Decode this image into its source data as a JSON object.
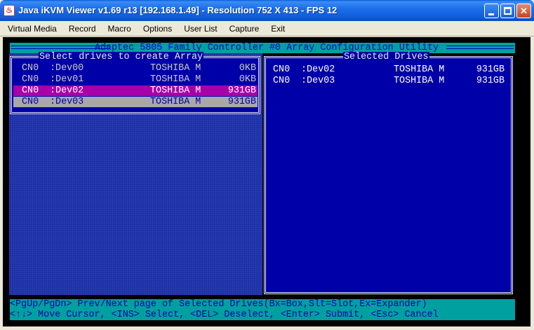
{
  "window": {
    "title": "Java iKVM Viewer v1.69 r13 [192.168.1.49]  - Resolution 752 X 413 - FPS 12",
    "app_icon": "java-cup-icon"
  },
  "menu": [
    "Virtual Media",
    "Record",
    "Macro",
    "Options",
    "User List",
    "Capture",
    "Exit"
  ],
  "console": {
    "header": " Adaptec 5805 Family Controller #0 Array Configuration Utility ",
    "left_title": "Select drives to create Array",
    "right_title": "Selected Drives",
    "drives": [
      {
        "channel": "CN0",
        "device": ":Dev00",
        "vendor": "TOSHIBA M",
        "size": "0KB",
        "state": "normal"
      },
      {
        "channel": "CN0",
        "device": ":Dev01",
        "vendor": "TOSHIBA M",
        "size": "0KB",
        "state": "normal"
      },
      {
        "channel": "CN0",
        "device": ":Dev02",
        "vendor": "TOSHIBA M",
        "size": "931GB",
        "state": "selected"
      },
      {
        "channel": "CN0",
        "device": ":Dev03",
        "vendor": "TOSHIBA M",
        "size": "931GB",
        "state": "cursor"
      }
    ],
    "selected": [
      {
        "channel": "CN0",
        "device": ":Dev02",
        "vendor": "TOSHIBA M",
        "size": "931GB"
      },
      {
        "channel": "CN0",
        "device": ":Dev03",
        "vendor": "TOSHIBA M",
        "size": "931GB"
      }
    ],
    "footer": [
      "<PgUp/PgDn> Prev/Next page of Selected Drives(Bx=Box,Slt=Slot,Ex=Expander)",
      "<↑↓> Move Cursor, <INS> Select, <DEL> Deselect, <Enter> Submit, <Esc> Cancel"
    ]
  },
  "colors": {
    "console_bg": "#000000",
    "panel_blue": "#0000a8",
    "cyan_band": "#00a0a0",
    "highlight_selected": "#a800a8",
    "highlight_cursor": "#a8a8a8"
  }
}
